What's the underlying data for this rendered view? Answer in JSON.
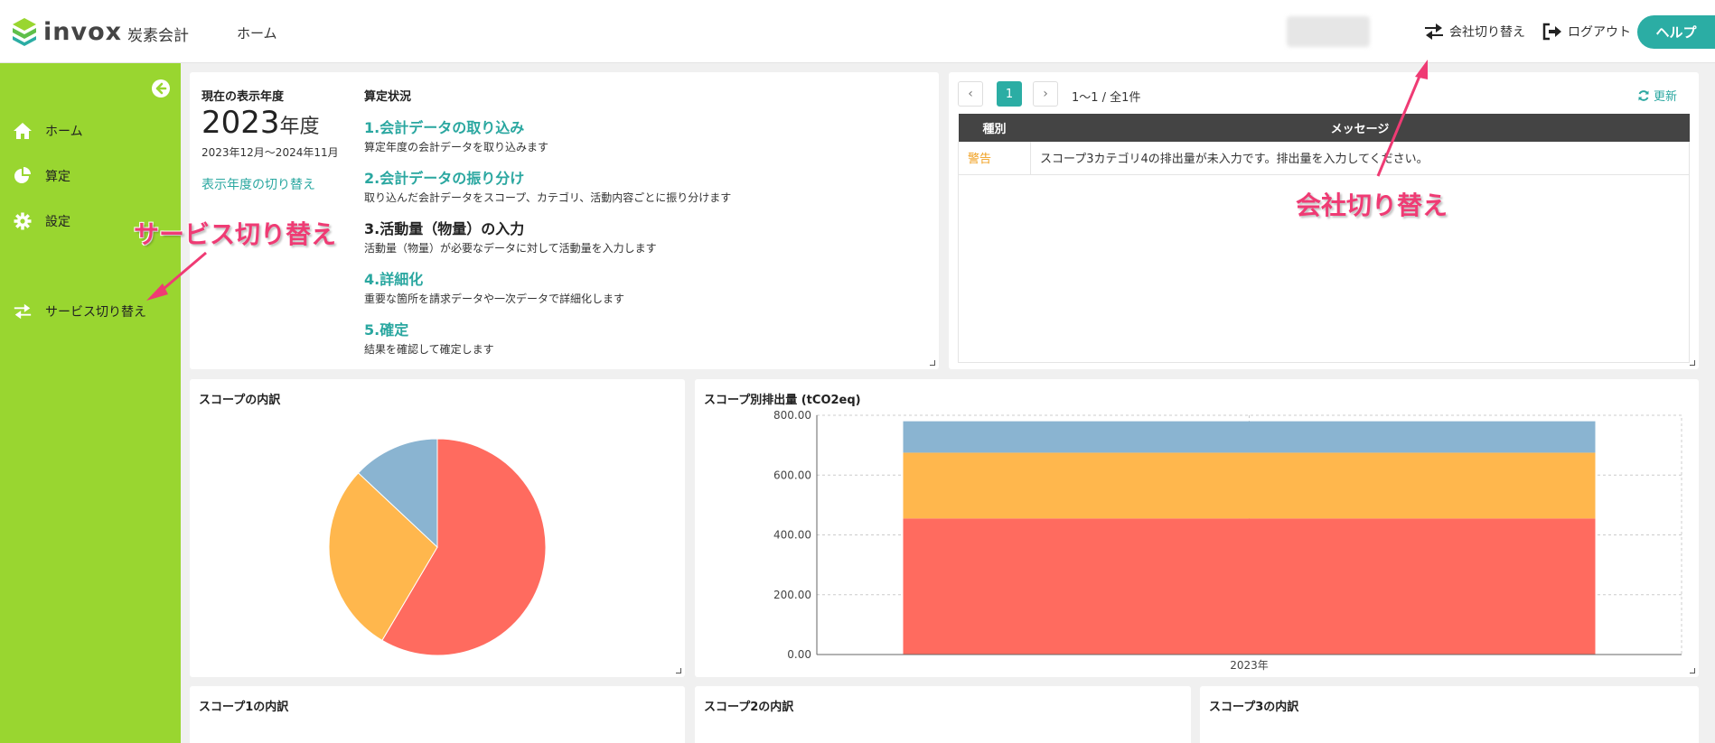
{
  "header": {
    "logo_text": "invox",
    "logo_sub": "炭素会計",
    "nav_home": "ホーム",
    "company_switch": "会社切り替え",
    "logout": "ログアウト",
    "help": "ヘルプ",
    "accent_color": "#2bada4"
  },
  "sidebar": {
    "bg_color": "#99d630",
    "items": [
      {
        "label": "ホーム",
        "icon": "home-icon"
      },
      {
        "label": "算定",
        "icon": "pie-chart-icon"
      },
      {
        "label": "設定",
        "icon": "gear-icon"
      },
      {
        "label": "サービス切り替え",
        "icon": "switch-icon"
      }
    ]
  },
  "status": {
    "year_label": "現在の表示年度",
    "year_value": "2023",
    "year_unit": "年度",
    "period": "2023年12月～2024年11月",
    "switch_year": "表示年度の切り替え",
    "progress_label": "算定状況",
    "steps": [
      {
        "title": "1.会計データの取り込み",
        "desc": "算定年度の会計データを取り込みます"
      },
      {
        "title": "2.会計データの振り分け",
        "desc": "取り込んだ会計データをスコープ、カテゴリ、活動内容ごとに振り分けます"
      },
      {
        "title": "3.活動量（物量）の入力",
        "desc": "活動量（物量）が必要なデータに対して活動量を入力します"
      },
      {
        "title": "4.詳細化",
        "desc": "重要な箇所を請求データや一次データで詳細化します"
      },
      {
        "title": "5.確定",
        "desc": "結果を確認して確定します"
      }
    ]
  },
  "messages": {
    "page_current": "1",
    "page_info": "1〜1 / 全1件",
    "refresh": "更新",
    "col_type": "種別",
    "col_message": "メッセージ",
    "rows": [
      {
        "type": "警告",
        "message": "スコープ3カテゴリ4の排出量が未入力です。排出量を入力してください。"
      }
    ]
  },
  "annotations": {
    "service_switch": "サービス切り替え",
    "company_switch": "会社切り替え"
  },
  "pie": {
    "title": "スコープの内訳"
  },
  "bar": {
    "title": "スコープ別排出量 (tCO2eq)"
  },
  "bottom": {
    "scope1": "スコープ1の内訳",
    "scope2": "スコープ2の内訳",
    "scope3": "スコープ3の内訳"
  },
  "chart_data": [
    {
      "type": "pie",
      "title": "スコープの内訳",
      "slices": [
        {
          "value": 58.5,
          "color": "#ff6b5f"
        },
        {
          "value": 28.5,
          "color": "#ffb74d"
        },
        {
          "value": 13.0,
          "color": "#8ab4d1"
        }
      ]
    },
    {
      "type": "bar",
      "stacked": true,
      "title": "スコープ別排出量 (tCO2eq)",
      "categories": [
        "2023年"
      ],
      "series": [
        {
          "values": [
            455
          ],
          "color": "#ff6b5f"
        },
        {
          "values": [
            220
          ],
          "color": "#ffb74d"
        },
        {
          "values": [
            105
          ],
          "color": "#8ab4d1"
        }
      ],
      "yticks": [
        "0.00",
        "200.00",
        "400.00",
        "600.00",
        "800.00"
      ],
      "ylim": [
        0,
        800
      ],
      "grid": true
    }
  ]
}
